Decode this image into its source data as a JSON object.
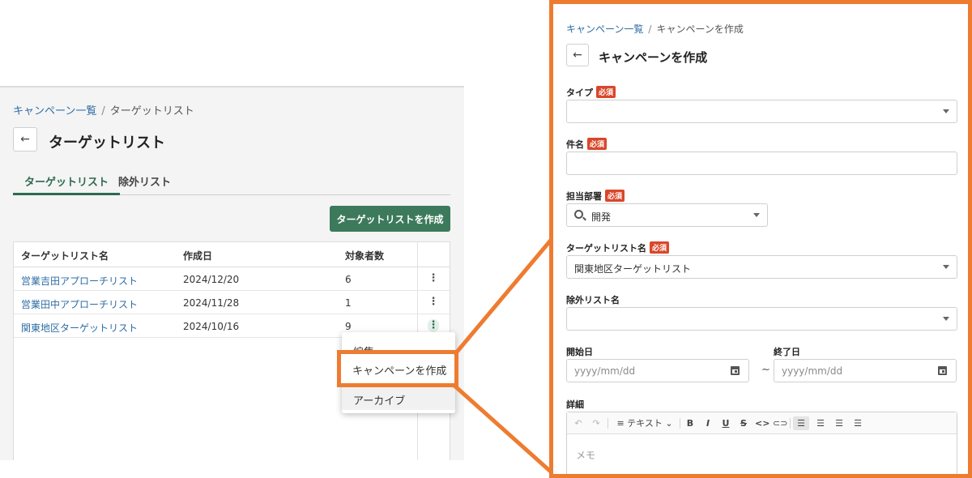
{
  "left": {
    "breadcrumb": {
      "parent": "キャンペーン一覧",
      "separator": "/",
      "current": "ターゲットリスト"
    },
    "title": "ターゲットリスト",
    "tabs": [
      {
        "label": "ターゲットリスト",
        "active": true
      },
      {
        "label": "除外リスト",
        "active": false
      }
    ],
    "create_button": "ターゲットリストを作成",
    "table": {
      "headers": [
        "ターゲットリスト名",
        "作成日",
        "対象者数"
      ],
      "rows": [
        {
          "name": "営業吉田アプローチリスト",
          "date": "2024/12/20",
          "count": "6"
        },
        {
          "name": "営業田中アプローチリスト",
          "date": "2024/11/28",
          "count": "1"
        },
        {
          "name": "関東地区ターゲットリスト",
          "date": "2024/10/16",
          "count": "9"
        }
      ]
    },
    "menu": {
      "items": [
        "編集",
        "キャンペーンを作成",
        "アーカイブ"
      ]
    }
  },
  "right": {
    "breadcrumb": {
      "parent": "キャンペーン一覧",
      "separator": "/",
      "current": "キャンペーンを作成"
    },
    "title": "キャンペーンを作成",
    "required_badge": "必須",
    "fields": {
      "type": {
        "label": "タイプ",
        "value": ""
      },
      "subject": {
        "label": "件名",
        "value": ""
      },
      "department": {
        "label": "担当部署",
        "value": "開発"
      },
      "target_list": {
        "label": "ターゲットリスト名",
        "value": "関東地区ターゲットリスト"
      },
      "exclude_list": {
        "label": "除外リスト名",
        "value": ""
      },
      "start_date": {
        "label": "開始日",
        "placeholder": "yyyy/mm/dd"
      },
      "end_date": {
        "label": "終了日",
        "placeholder": "yyyy/mm/dd"
      },
      "tilde": "~",
      "details": {
        "label": "詳細",
        "placeholder": "メモ"
      }
    },
    "editor": {
      "text_style": "テキスト",
      "bold": "B",
      "italic": "I",
      "underline": "U",
      "strike": "S",
      "code": "<>"
    }
  },
  "colors": {
    "accent_green": "#3c7a5b",
    "highlight_orange": "#ee7c30",
    "required_red": "#d9472b",
    "link_blue": "#2e6da4"
  }
}
